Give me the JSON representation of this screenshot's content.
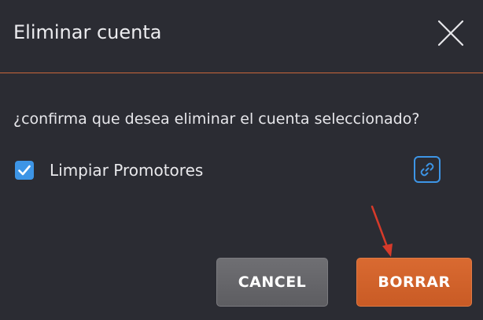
{
  "dialog": {
    "title": "Eliminar cuenta",
    "close_icon": "close-icon",
    "message": "¿confirma que desea eliminar el cuenta seleccionado?",
    "checkbox": {
      "label": "Limpiar Promotores",
      "checked": true,
      "icon": "checkmark-icon"
    },
    "link_icon": "link-icon",
    "buttons": {
      "cancel_label": "CANCEL",
      "delete_label": "BORRAR"
    }
  },
  "colors": {
    "background": "#2b2c33",
    "divider": "#c8663a",
    "checkbox": "#3d95e6",
    "cancel_button": "#66666a",
    "delete_button": "#d0622b",
    "annotation_arrow": "#d63a2a"
  }
}
